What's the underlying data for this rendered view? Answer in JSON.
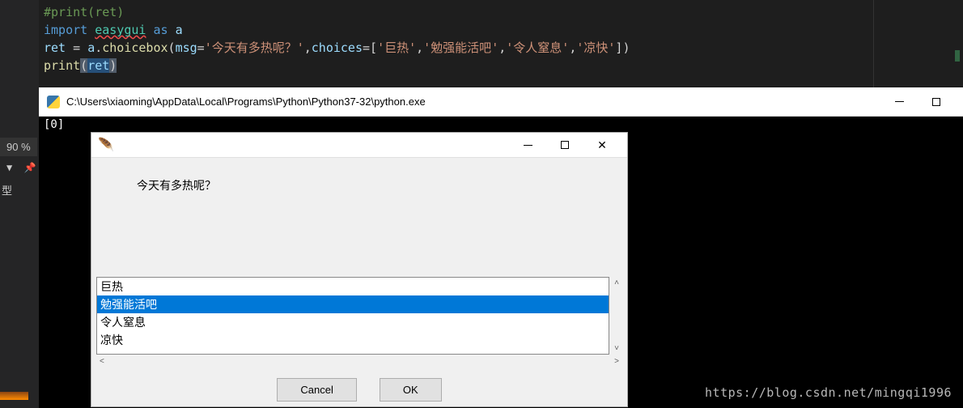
{
  "editor": {
    "line1_comment": "#print(ret)",
    "line2": {
      "kw_import": "import",
      "module": "easygui",
      "kw_as": "as",
      "alias": "a"
    },
    "line3": {
      "ret": "ret",
      "eq": "=",
      "obj": "a",
      "dot": ".",
      "fn": "choicebox",
      "lp": "(",
      "arg1": "msg",
      "a1eq": "=",
      "s1": "'今天有多热呢？'",
      "comma1": ",",
      "arg2": "choices",
      "a2eq": "=",
      "lbr": "[",
      "c1": "'巨热'",
      "cm1": ",",
      "c2": "'勉强能活吧'",
      "cm2": ",",
      "c3": "'令人窒息'",
      "cm3": ",",
      "c4": "'凉快'",
      "rbr": "]",
      "rp": ")"
    },
    "line4": {
      "print": "print",
      "lp": "(",
      "ret": "ret",
      "rp": ")"
    }
  },
  "sidebar": {
    "zoom": "90 %",
    "footer_label": "型"
  },
  "console": {
    "title": "C:\\Users\\xiaoming\\AppData\\Local\\Programs\\Python\\Python37-32\\python.exe",
    "output": "[0]"
  },
  "dialog": {
    "message": "今天有多热呢？",
    "items": [
      "巨热",
      "勉强能活吧",
      "令人窒息",
      "凉快"
    ],
    "selected_index": 1,
    "buttons": {
      "cancel": "Cancel",
      "ok": "OK"
    }
  },
  "watermark": "https://blog.csdn.net/mingqi1996"
}
